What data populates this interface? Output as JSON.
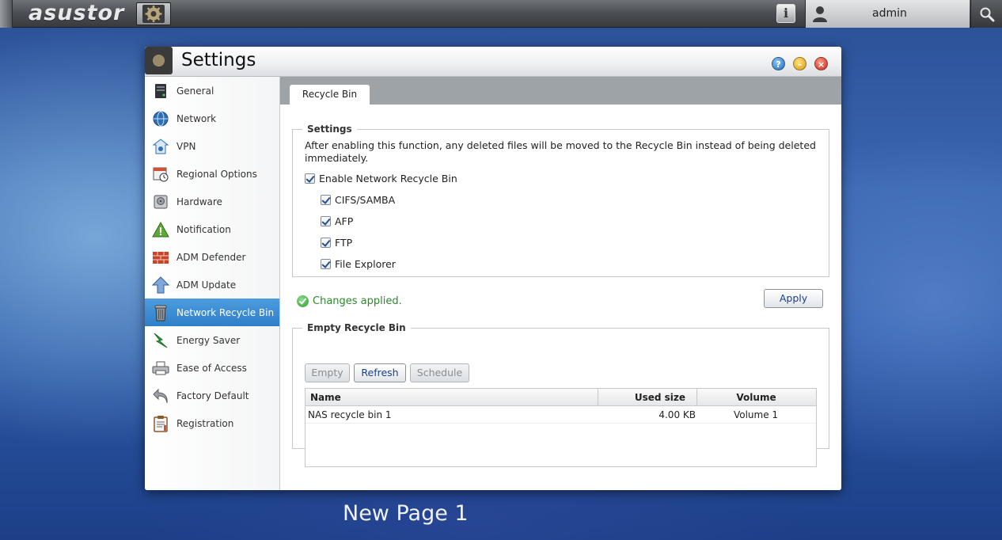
{
  "topbar": {
    "brand": "asustor",
    "user_name": "admin",
    "icons": [
      "settings-app-icon",
      "info-icon",
      "user-avatar-icon",
      "search-icon"
    ]
  },
  "window": {
    "title": "Settings",
    "buttons": [
      "help-icon",
      "minimize-icon",
      "close-icon"
    ]
  },
  "sidebar": {
    "items": [
      {
        "label": "General",
        "icon": "server-icon"
      },
      {
        "label": "Network",
        "icon": "globe-icon"
      },
      {
        "label": "VPN",
        "icon": "vpn-icon"
      },
      {
        "label": "Regional Options",
        "icon": "calendar-clock-icon"
      },
      {
        "label": "Hardware",
        "icon": "hard-drive-icon"
      },
      {
        "label": "Notification",
        "icon": "warning-icon"
      },
      {
        "label": "ADM Defender",
        "icon": "firewall-icon"
      },
      {
        "label": "ADM Update",
        "icon": "update-arrow-icon"
      },
      {
        "label": "Network Recycle Bin",
        "icon": "recycle-bin-icon"
      },
      {
        "label": "Energy Saver",
        "icon": "energy-bolt-icon"
      },
      {
        "label": "Ease of Access",
        "icon": "printer-icon"
      },
      {
        "label": "Factory Default",
        "icon": "undo-icon"
      },
      {
        "label": "Registration",
        "icon": "clipboard-icon"
      }
    ],
    "active_index": 8
  },
  "content": {
    "tab_label": "Recycle Bin",
    "settings_group": {
      "legend": "Settings",
      "description": "After enabling this function, any deleted files will be moved to the Recycle Bin instead of being deleted immediately.",
      "enable_label": "Enable Network Recycle Bin",
      "protocols": [
        {
          "label": "CIFS/SAMBA",
          "checked": true
        },
        {
          "label": "AFP",
          "checked": true
        },
        {
          "label": "FTP",
          "checked": true
        },
        {
          "label": "File Explorer",
          "checked": true
        }
      ]
    },
    "status_text": "Changes applied.",
    "apply_label": "Apply",
    "empty_group": {
      "legend": "Empty Recycle Bin",
      "empty_label": "Empty",
      "refresh_label": "Refresh",
      "schedule_label": "Schedule",
      "columns": [
        "Name",
        "Used size",
        "Volume"
      ],
      "rows": [
        {
          "name": "NAS recycle bin 1",
          "used_size": "4.00 KB",
          "volume": "Volume 1"
        }
      ]
    }
  },
  "desktop": {
    "page_label": "New Page 1"
  },
  "colors": {
    "accent": "#2f7fc8",
    "status_ok": "#2b8a2b",
    "tabstrip": "#9ea3a8"
  }
}
